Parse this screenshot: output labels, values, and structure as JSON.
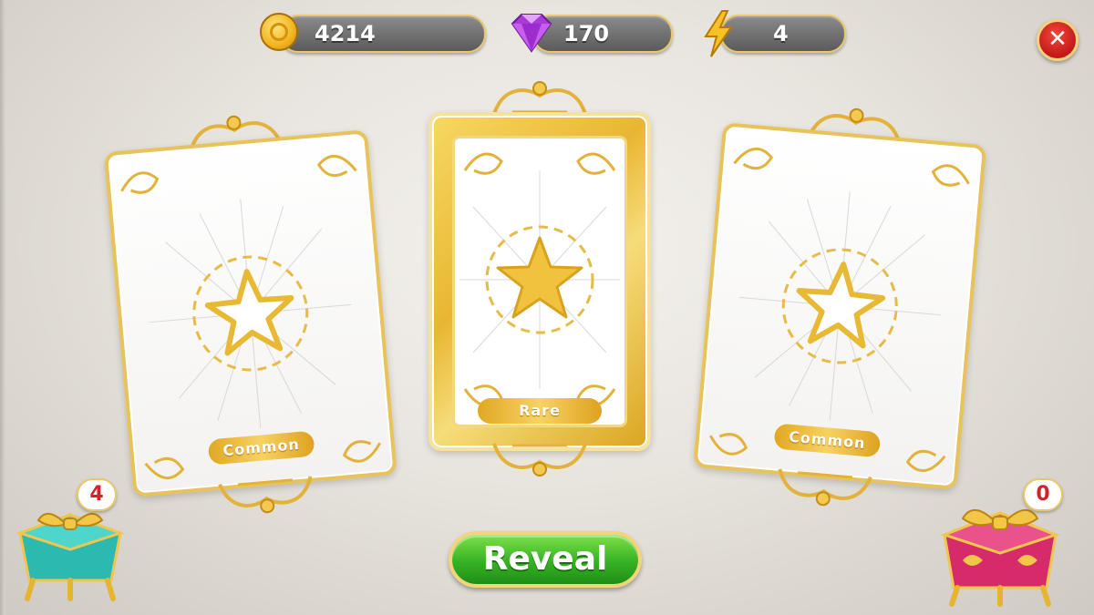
{
  "resources": {
    "coins": "4214",
    "gems": "170",
    "energy": "4"
  },
  "cards": [
    {
      "rarity": "Common"
    },
    {
      "rarity": "Rare"
    },
    {
      "rarity": "Common"
    }
  ],
  "reveal_label": "Reveal",
  "chests": {
    "left_count": "4",
    "right_count": "0"
  },
  "colors": {
    "gold": "#e8c25a",
    "reveal_green": "#36b224",
    "close_red": "#c3181a",
    "left_chest": "#2bb9b0",
    "right_chest": "#d62a6b"
  },
  "icons": [
    "coin-icon",
    "gem-icon",
    "lightning-icon",
    "close-icon",
    "star-icon",
    "gift-chest-icon"
  ]
}
